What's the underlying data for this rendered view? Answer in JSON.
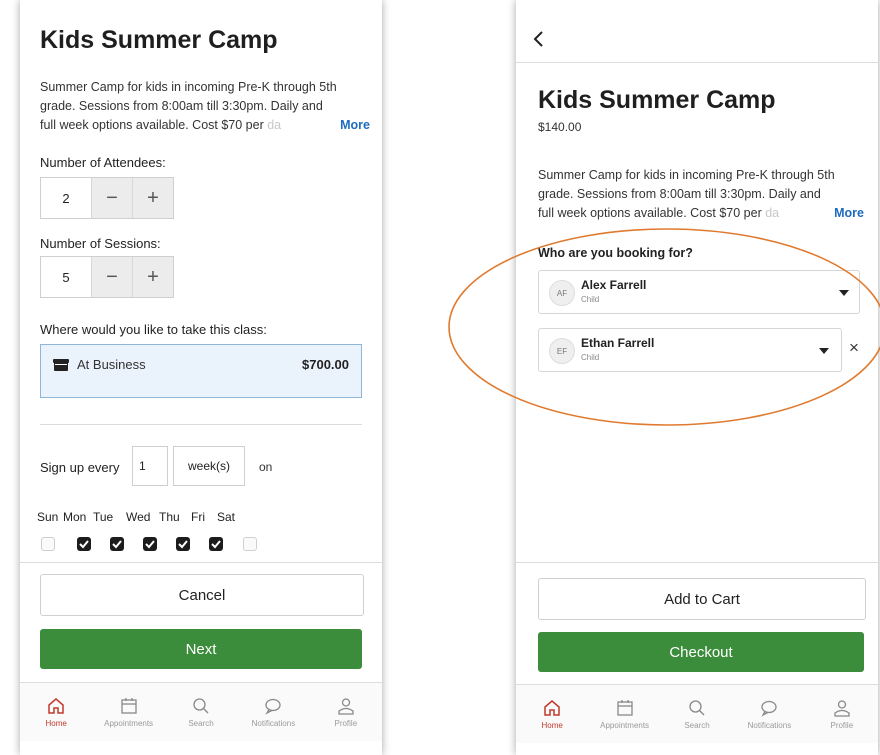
{
  "left": {
    "title": "Kids Summer Camp",
    "description": {
      "line1": "Summer Camp for kids in incoming Pre-K through 5th",
      "line2": "grade. Sessions from 8:00am till 3:30pm. Daily and",
      "line3_start": "full week options available. Cost $70 per ",
      "line3_faded": "da",
      "more": "More"
    },
    "attendees": {
      "label": "Number of Attendees:",
      "value": "2",
      "minus": "−",
      "plus": "+"
    },
    "sessions": {
      "label": "Number of Sessions:",
      "value": "5",
      "minus": "−",
      "plus": "+"
    },
    "location": {
      "label": "Where would you like to take this class:",
      "option": "At Business",
      "price": "$700.00",
      "icon": "store-icon"
    },
    "signup": {
      "prefix": "Sign up every",
      "value": "1",
      "unit": "week(s)",
      "suffix": "on"
    },
    "days": [
      {
        "label": "Sun",
        "checked": false
      },
      {
        "label": "Mon",
        "checked": true
      },
      {
        "label": "Tue",
        "checked": true
      },
      {
        "label": "Wed",
        "checked": true
      },
      {
        "label": "Thu",
        "checked": true
      },
      {
        "label": "Fri",
        "checked": true
      },
      {
        "label": "Sat",
        "checked": false
      }
    ],
    "cancel": "Cancel",
    "next": "Next"
  },
  "right": {
    "back_icon": "back-chevron-icon",
    "title": "Kids Summer Camp",
    "price": "$140.00",
    "description": {
      "line1": "Summer Camp for kids in incoming Pre-K through 5th",
      "line2": "grade. Sessions from 8:00am till 3:30pm. Daily and",
      "line3_start": "full week options available. Cost $70 per ",
      "line3_faded": "da",
      "more": "More"
    },
    "booking_label": "Who are you booking for?",
    "people": [
      {
        "initials": "AF",
        "name": "Alex Farrell",
        "role": "Child"
      },
      {
        "initials": "EF",
        "name": "Ethan Farrell",
        "role": "Child"
      }
    ],
    "remove": "×",
    "add_to_cart": "Add to Cart",
    "checkout": "Checkout"
  },
  "tabs": [
    {
      "label": "Home",
      "icon": "home-icon",
      "active": true
    },
    {
      "label": "Appointments",
      "icon": "calendar-icon",
      "active": false
    },
    {
      "label": "Search",
      "icon": "search-icon",
      "active": false
    },
    {
      "label": "Notifications",
      "icon": "chat-bubble-icon",
      "active": false
    },
    {
      "label": "Profile",
      "icon": "profile-icon",
      "active": false
    }
  ],
  "colors": {
    "accent_green": "#3b8c3b",
    "link_blue": "#1e6bc0",
    "home_red": "#c0392b",
    "annotation_orange": "#e07a2e"
  }
}
